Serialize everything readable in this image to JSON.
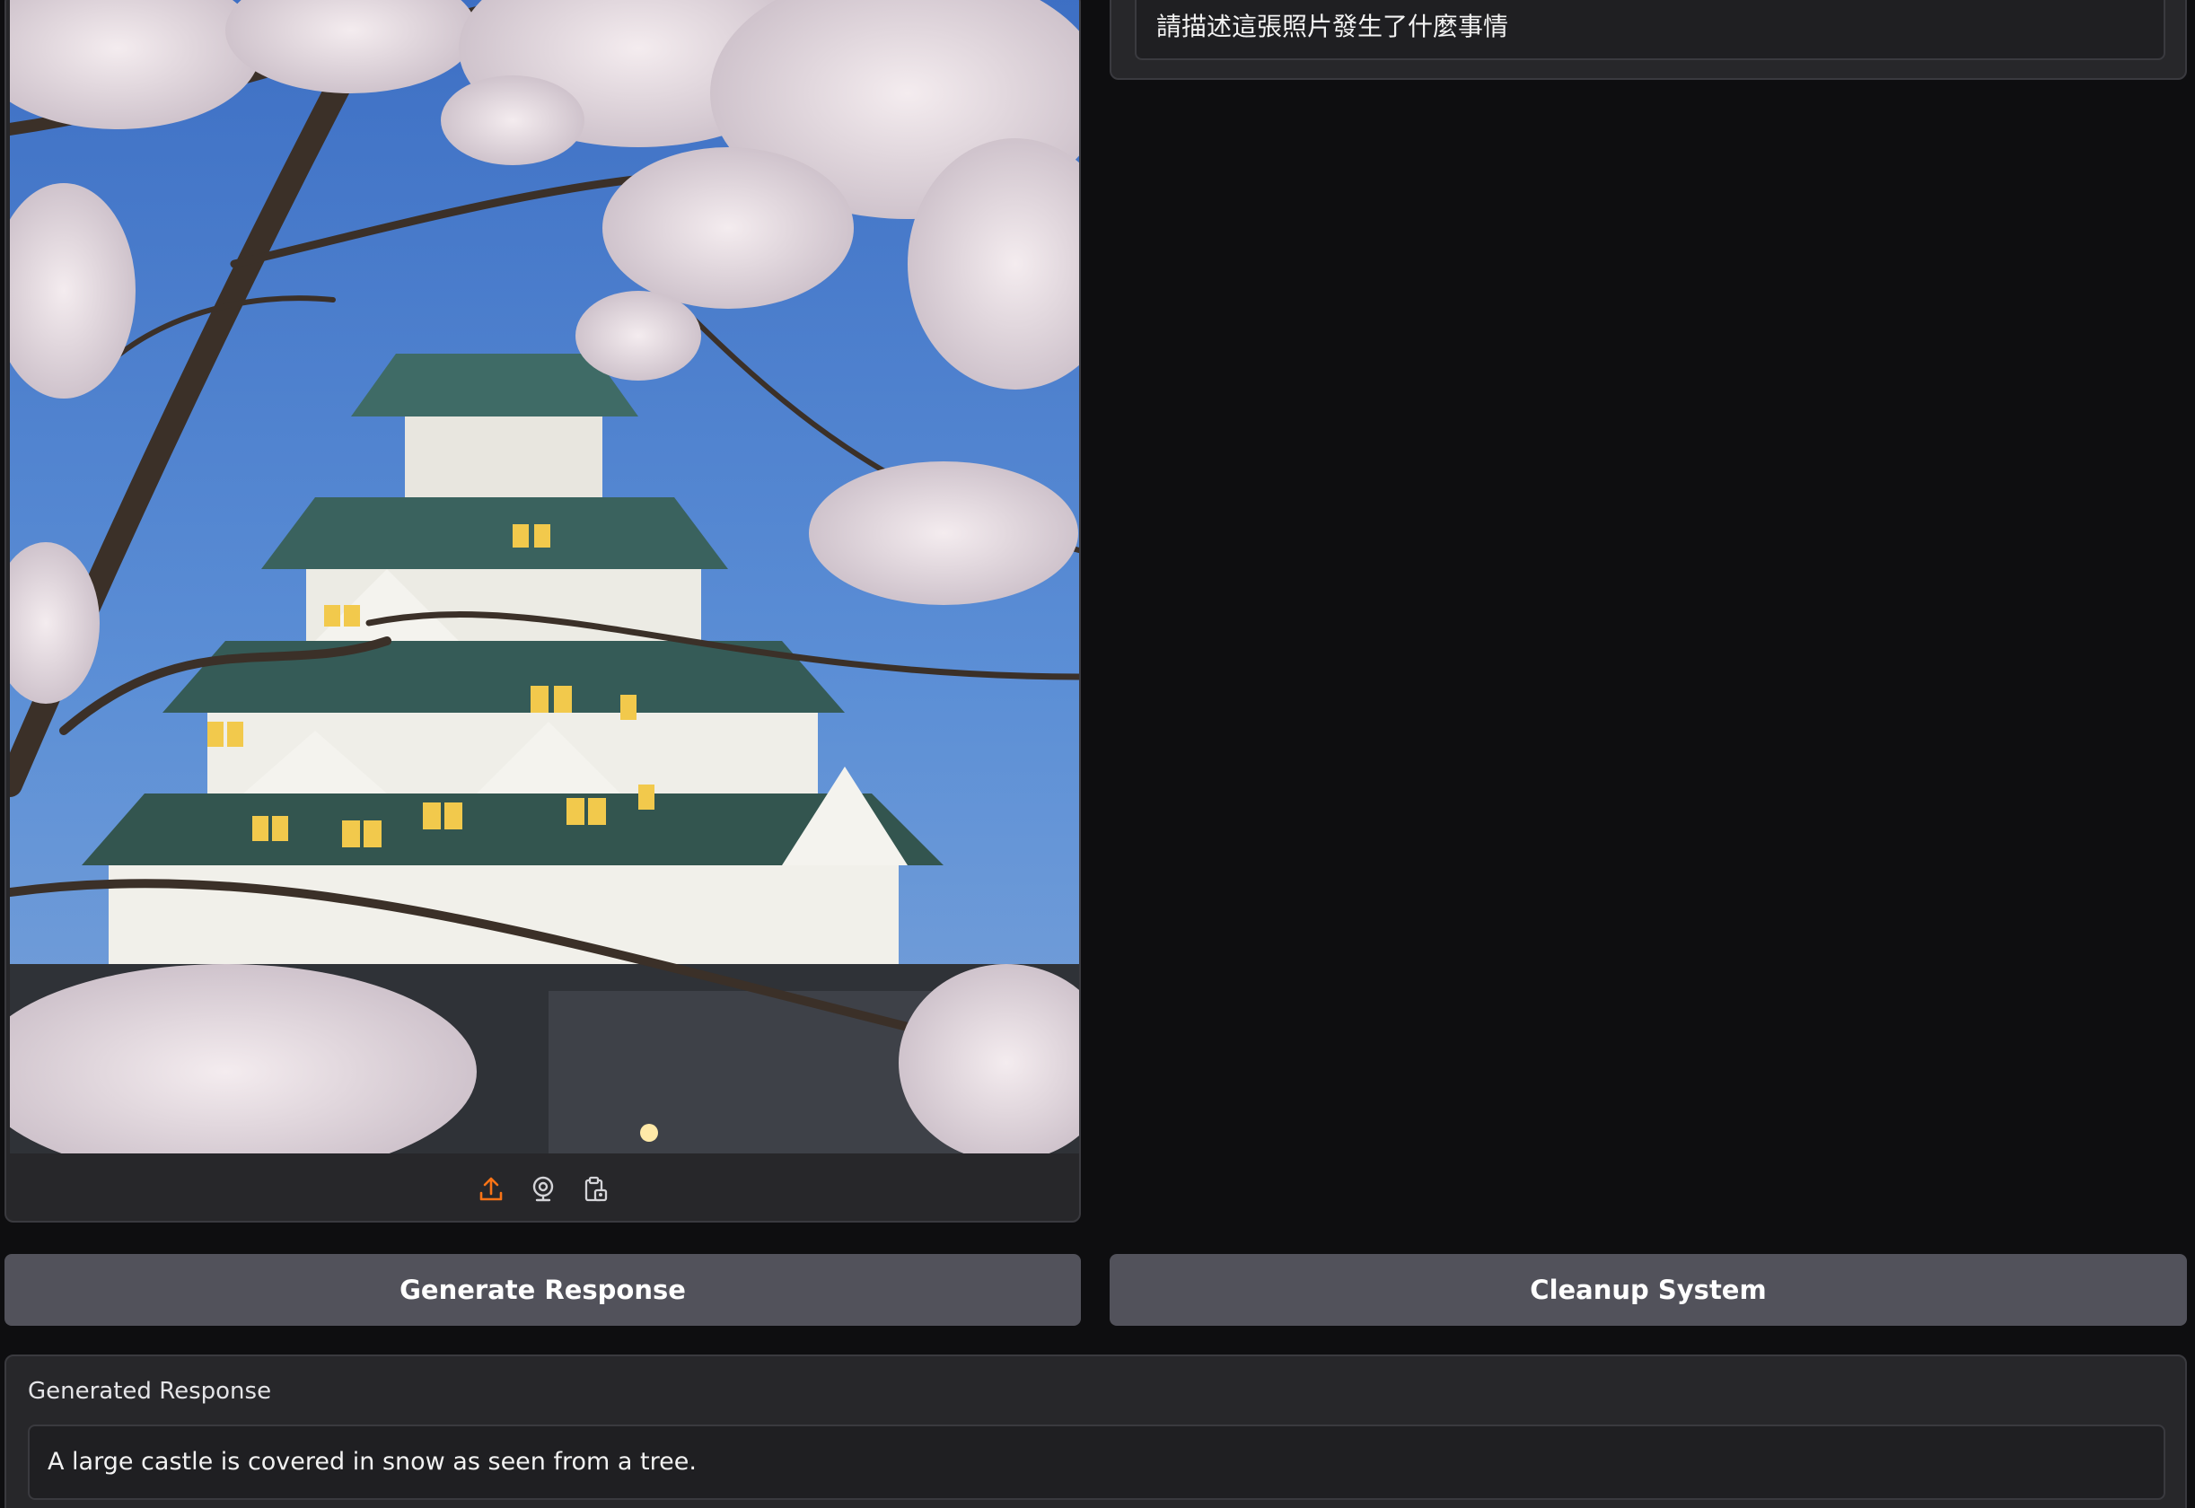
{
  "prompt": {
    "value": "請描述這張照片發生了什麼事情"
  },
  "image_toolbar": {
    "icons": [
      "upload-icon",
      "webcam-icon",
      "clipboard-paste-icon"
    ],
    "accent": "#f97316"
  },
  "buttons": {
    "generate_label": "Generate Response",
    "cleanup_label": "Cleanup System"
  },
  "output": {
    "label": "Generated Response",
    "value": "A large castle is covered in snow as seen from a tree."
  },
  "colors": {
    "background": "#0e0e10",
    "panel": "#27272a",
    "button": "#52525b",
    "text": "#f2f2f2"
  }
}
